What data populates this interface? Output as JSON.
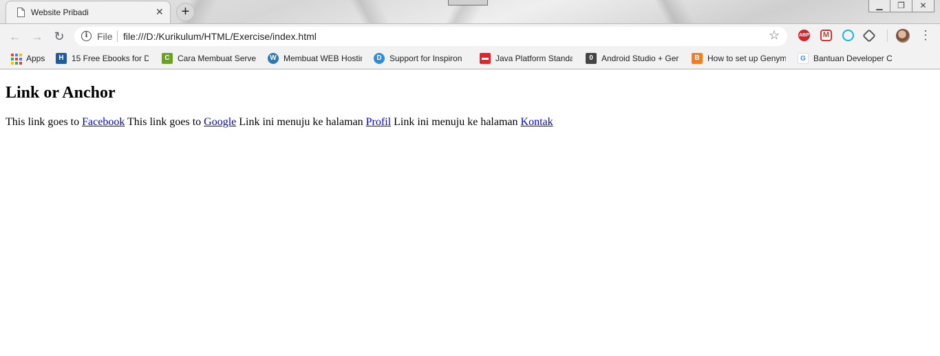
{
  "window": {
    "tab": {
      "title": "Website Pribadi",
      "close": "✕"
    },
    "new_tab": "+",
    "controls": {
      "minimize": "▁",
      "restore": "❐",
      "close": "✕"
    }
  },
  "toolbar": {
    "back": "←",
    "forward": "→",
    "reload": "↻",
    "info": "i",
    "scheme": "File",
    "url": "file:///D:/Kurikulum/HTML/Exercise/index.html",
    "star": "☆",
    "extensions": {
      "abp": "ABP",
      "gmail": "M"
    },
    "menu": "⋮"
  },
  "bookmarks": [
    {
      "label": "Apps",
      "icon": "apps-grid-icon"
    },
    {
      "label": "15 Free Ebooks for D",
      "icon": "h-square-icon",
      "glyph": "H",
      "color": "#1d5c9e"
    },
    {
      "label": "Cara Membuat Serve",
      "icon": "code-icon",
      "glyph": "C",
      "color": "#6aa321"
    },
    {
      "label": "Membuat WEB Hostin",
      "icon": "wordpress-icon",
      "glyph": "W",
      "color": "#2a7bb5"
    },
    {
      "label": "Support for Inspiron",
      "icon": "dell-icon",
      "glyph": "D",
      "color": "#2a8fd8"
    },
    {
      "label": "Java Platform Standa",
      "icon": "oracle-icon",
      "glyph": "▬",
      "color": "#e4242b"
    },
    {
      "label": "Android Studio + Ger",
      "icon": "zero-box-icon",
      "glyph": "0",
      "color": "#444444"
    },
    {
      "label": "How to set up Genym",
      "icon": "blogger-icon",
      "glyph": "B",
      "color": "#f57c1f"
    },
    {
      "label": "Bantuan Developer C",
      "icon": "google-icon",
      "glyph": "G",
      "color": "#4285f4"
    }
  ],
  "content": {
    "heading": "Link or Anchor",
    "segments": [
      {
        "text": "This link goes to ",
        "link": "Facebook"
      },
      {
        "text": " This link goes to ",
        "link": "Google"
      },
      {
        "text": " Link ini menuju ke halaman ",
        "link": "Profil"
      },
      {
        "text": " Link ini menuju ke halaman ",
        "link": "Kontak"
      }
    ]
  },
  "colors": {
    "link": "#0000ee",
    "toolbar_bg": "#f2f2f2",
    "apps_dots": [
      "#ea4335",
      "#4285f4",
      "#fbbc05",
      "#34a853",
      "#ea4335",
      "#4285f4",
      "#fbbc05",
      "#34a853",
      "#ea4335"
    ]
  }
}
